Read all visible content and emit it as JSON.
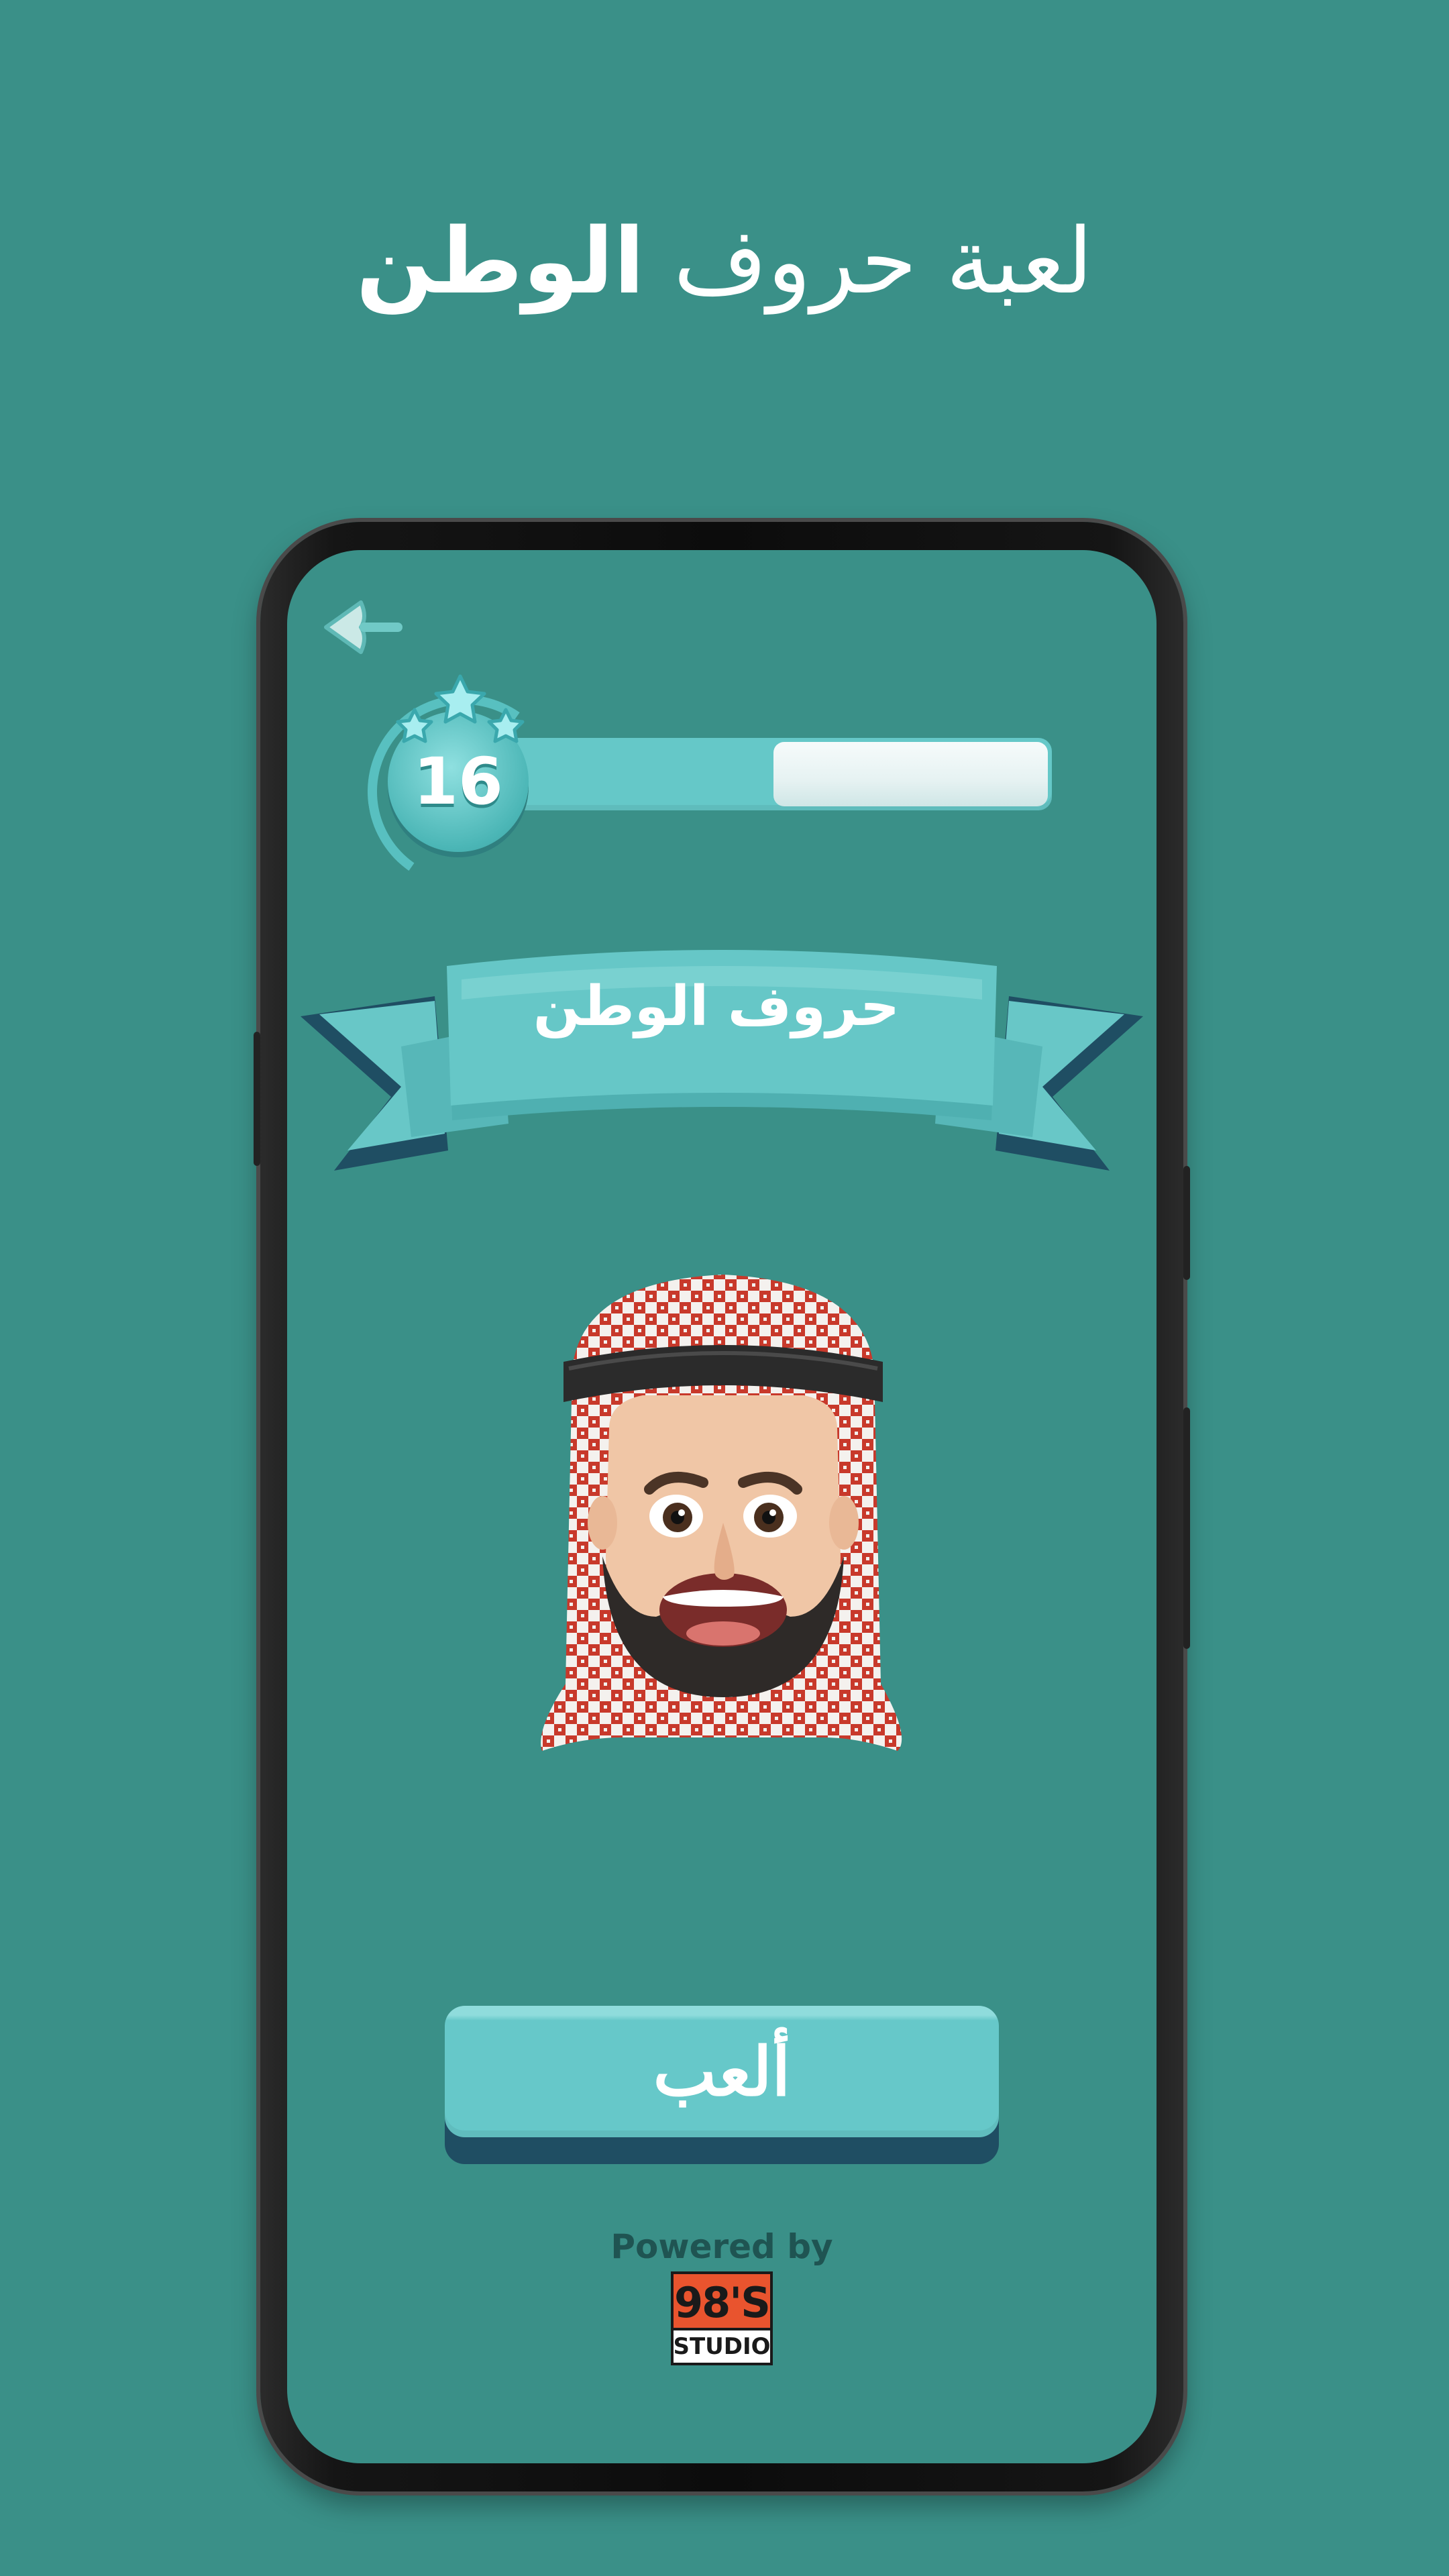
{
  "headline": {
    "light": "لعبة حروف",
    "bold": "الوطن"
  },
  "game": {
    "level": "16",
    "level_progress": 0.5,
    "title": "حروف الوطن",
    "play_label": "ألعب",
    "powered_by": "Powered by",
    "studio_logo": {
      "top": "98'S",
      "bottom": "STUDIO"
    }
  },
  "icons": {
    "back": "back-arrow-icon",
    "stars": "stars-icon",
    "avatar": "saudi-memoji-avatar"
  },
  "colors": {
    "background": "#3a9088",
    "accent": "#66c8c9",
    "button_shadow": "#1f4e63",
    "text": "#ffffff"
  }
}
